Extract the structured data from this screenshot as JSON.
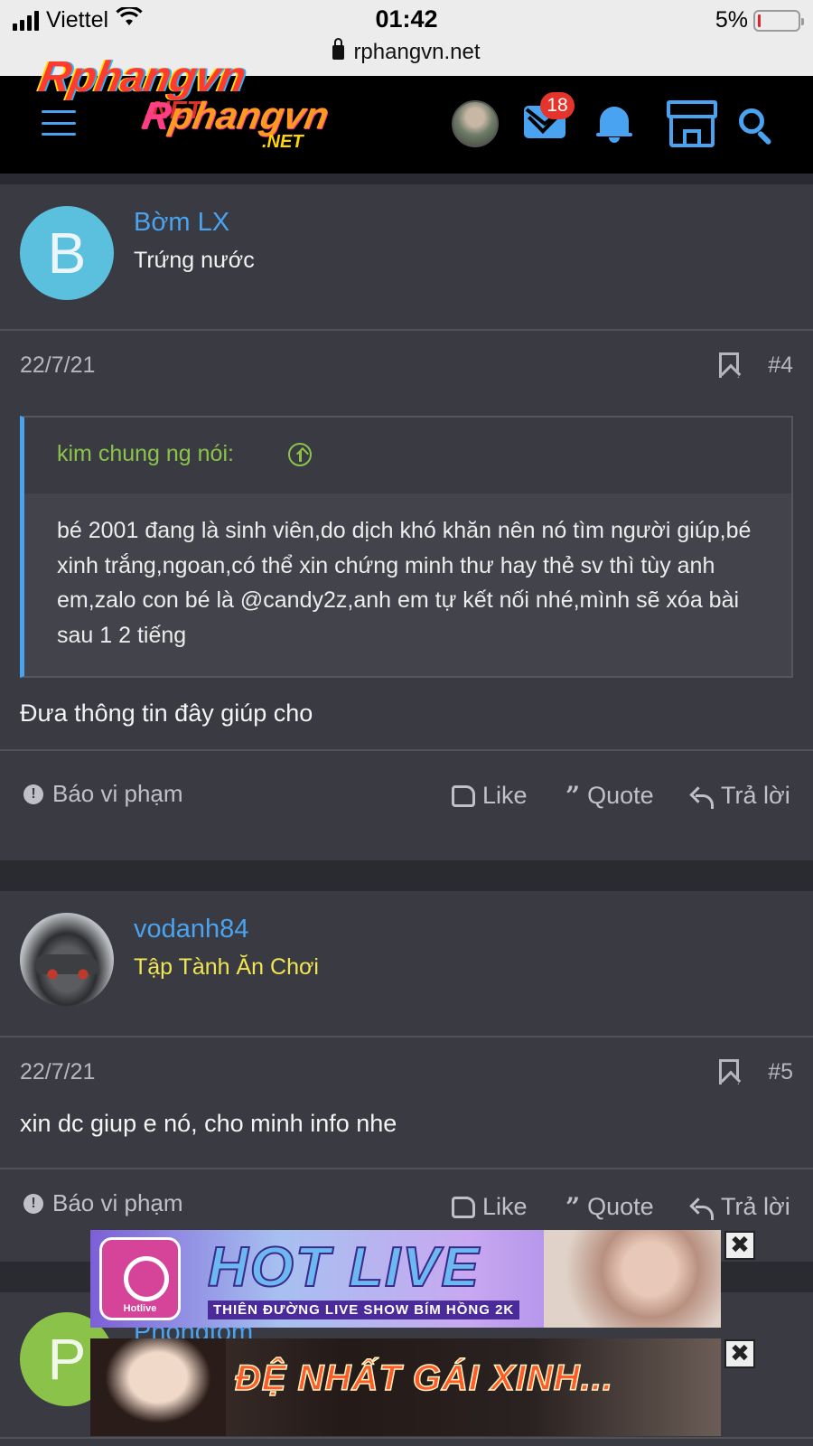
{
  "status_bar": {
    "carrier": "Viettel",
    "time": "01:42",
    "battery": "5%",
    "url": "rphangvn.net"
  },
  "header": {
    "logo_text": "Rphangvn",
    "logo_suffix": ".NET",
    "inbox_badge": "18",
    "icons": [
      "menu-icon",
      "avatar",
      "mail-icon",
      "bell-icon",
      "store-icon",
      "search-icon"
    ],
    "accent_color": "#4aa3f0"
  },
  "posts": [
    {
      "avatar_letter": "B",
      "avatar_color": "#5bc0de",
      "username": "Bờm LX",
      "user_title": "Trứng nước",
      "date": "22/7/21",
      "post_number": "#4",
      "quote": {
        "author": "kim chung ng nói:",
        "text": "bé 2001 đang là sinh viên,do dịch khó khăn nên nó tìm người giúp,bé xinh trắng,ngoan,có thể xin chứng minh thư hay thẻ sv thì tùy anh em,zalo con bé là @candy2z,anh em tự kết nối nhé,mình sẽ xóa bài sau 1 2 tiếng"
      },
      "body": "Đưa thông tin đây giúp cho"
    },
    {
      "username": "vodanh84",
      "user_title": "Tập Tành Ăn Chơi",
      "date": "22/7/21",
      "post_number": "#5",
      "body": "xin dc giup e nó, cho minh info nhe"
    },
    {
      "avatar_letter": "P",
      "avatar_color": "#8bc34a",
      "username": "Phongtom"
    }
  ],
  "actions": {
    "report": "Báo vi phạm",
    "like": "Like",
    "quote": "Quote",
    "reply": "Trả lời"
  },
  "ads": [
    {
      "title": "HOT LIVE",
      "subtitle": "THIÊN ĐƯỜNG LIVE SHOW BÍM HỒNG 2K",
      "logo_text": "Hotlive",
      "close": "✖"
    },
    {
      "title": "ĐỆ NHẤT GÁI XINH...",
      "close": "✖"
    }
  ]
}
